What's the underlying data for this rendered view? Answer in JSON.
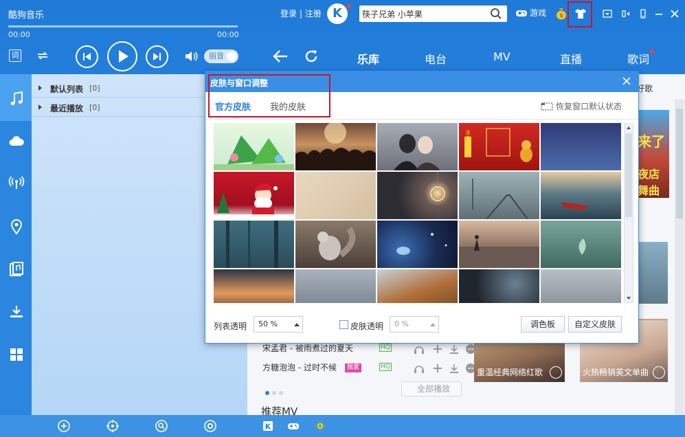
{
  "app": {
    "title": "酷狗音乐",
    "login_label": "登录",
    "register_label": "注册",
    "logo_letter": "K",
    "search_value": "筷子兄弟 小苹果",
    "game_label": "游戏"
  },
  "player": {
    "time_current": "00:00",
    "time_total": "00:00",
    "lyric_label": "词",
    "quality_label": "丽音",
    "progress": 0
  },
  "nav": {
    "tabs": [
      "乐库",
      "电台",
      "MV",
      "直播",
      "歌词"
    ],
    "active_index": 0
  },
  "playlists": [
    {
      "name": "默认列表",
      "count": "[0]"
    },
    {
      "name": "最近播放",
      "count": "[0]"
    }
  ],
  "content": {
    "top_cut_label": "好歌",
    "banner_text_1": "来了",
    "banner_text_2": "夜店",
    "banner_text_3": "舞曲",
    "songs": [
      {
        "title": "宋孟君 - 被雨煮过的夏天",
        "hq": "HQ",
        "tag": ""
      },
      {
        "title": "方糖泡泡 - 过时不候",
        "hq": "HQ",
        "tag": "独家"
      }
    ],
    "mv_cards": [
      {
        "caption": "重温经典网络红歌"
      },
      {
        "caption": "火热畅销英文单曲"
      }
    ],
    "play_all_label": "全部播放",
    "section_title": "推荐MV"
  },
  "dialog": {
    "title": "皮肤与窗口调整",
    "tabs": [
      "官方皮肤",
      "我的皮肤"
    ],
    "active_tab": 0,
    "restore_label": "恢复窗口默认状态",
    "skin_texts": {
      "festival_1": "送大年"
    },
    "list_transparency_label": "列表透明",
    "list_transparency_value": "50 %",
    "skin_transparency_label": "皮肤透明",
    "skin_transparency_value": "0 %",
    "skin_transparency_checked": false,
    "palette_button": "调色板",
    "custom_skin_button": "自定义皮肤"
  },
  "colors": {
    "brand_blue": "#2b82d9",
    "highlight_red": "#c8162a",
    "badge_red": "#ff3b3b"
  }
}
